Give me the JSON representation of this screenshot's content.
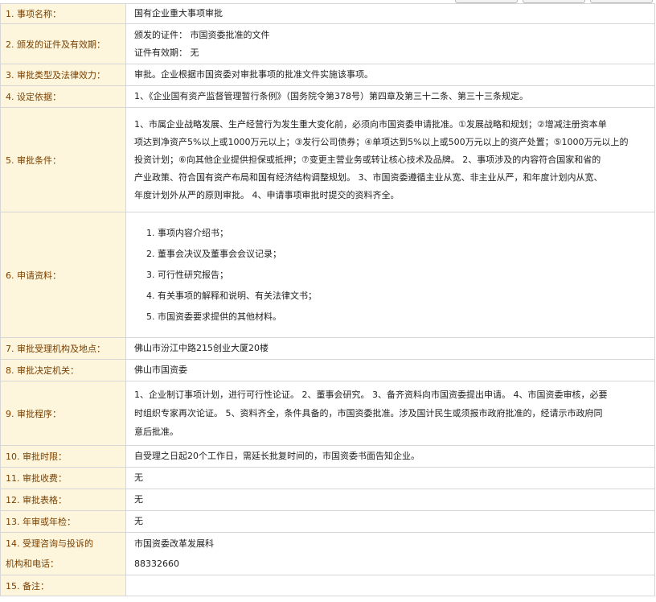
{
  "rows": [
    {
      "label": "1. 事项名称：",
      "lines": [
        "国有企业重大事项审批"
      ]
    },
    {
      "label": "2. 颁发的证件及有效期：",
      "lines": [
        "颁发的证件：  市国资委批准的文件",
        "证件有效期：  无"
      ]
    },
    {
      "label": "3. 审批类型及法律效力：",
      "lines": [
        "审批。企业根据市国资委对审批事项的批准文件实施该事项。"
      ]
    },
    {
      "label": "4. 设定依据：",
      "lines": [
        "1、《企业国有资产监督管理暂行条例》（国务院令第378号）第四章及第三十二条、第三十三条规定。"
      ]
    },
    {
      "label": "5. 审批条件：",
      "lines": [
        "1、市属企业战略发展、生产经营行为发生重大变化前，必须向市国资委申请批准。①发展战略和规划；②增减注册资本单",
        "项达到净资产5%以上或1000万元以上；③发行公司债券；④单项达到5%以上或500万元以上的资产处置；⑤1000万元以上的",
        "投资计划；⑥向其他企业提供担保或抵押；⑦变更主营业务或转让核心技术及品牌。 2、事项涉及的内容符合国家和省的",
        "产业政策、符合国有资产布局和国有经济结构调整规划。 3、市国资委遵循主业从宽、非主业从严，和年度计划内从宽、",
        "年度计划外从严的原则审批。 4、申请事项审批时提交的资料齐全。"
      ]
    },
    {
      "label": "6. 申请资料：",
      "lines": [
        "1. 事项内容介绍书；",
        "2. 董事会决议及董事会会议记录；",
        "3. 可行性研究报告；",
        "4. 有关事项的解释和说明、有关法律文书；",
        "5. 市国资委要求提供的其他材料。"
      ]
    },
    {
      "label": "7. 审批受理机构及地点：",
      "lines": [
        "佛山市汾江中路215创业大厦20楼"
      ]
    },
    {
      "label": "8. 审批决定机关：",
      "lines": [
        "佛山市国资委"
      ]
    },
    {
      "label": "9. 审批程序：",
      "lines": [
        "1、企业制订事项计划，进行可行性论证。 2、董事会研究。 3、备齐资料向市国资委提出申请。 4、市国资委审核，必要",
        "时组织专家再次论证。 5、资料齐全，条件具备的，市国资委批准。涉及国计民生或须报市政府批准的，经请示市政府同",
        "意后批准。"
      ]
    },
    {
      "label": "10. 审批时限：",
      "lines": [
        "自受理之日起20个工作日，需延长批复时间的，市国资委书面告知企业。"
      ]
    },
    {
      "label": "11. 审批收费：",
      "lines": [
        "无"
      ]
    },
    {
      "label": "12. 审批表格：",
      "lines": [
        "无"
      ]
    },
    {
      "label": "13. 年审或年检：",
      "lines": [
        "无"
      ]
    },
    {
      "label_lines": [
        "14. 受理咨询与投诉的",
        "机构和电话："
      ],
      "lines": [
        "市国资委改革发展科",
        "88332660"
      ]
    },
    {
      "label": "15. 备注：",
      "lines": []
    }
  ]
}
